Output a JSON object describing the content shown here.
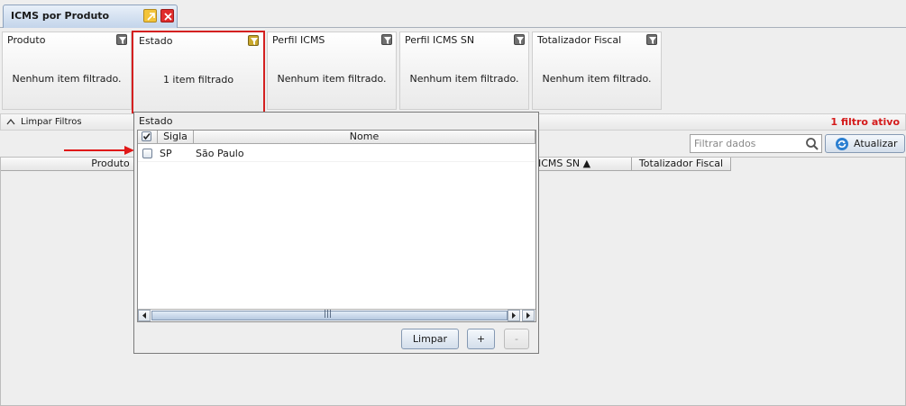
{
  "tab": {
    "title": "ICMS por Produto"
  },
  "cards": [
    {
      "title": "Produto",
      "message": "Nenhum item filtrado."
    },
    {
      "title": "Estado",
      "message": "1 item filtrado"
    },
    {
      "title": "Perfil ICMS",
      "message": "Nenhum item filtrado."
    },
    {
      "title": "Perfil ICMS SN",
      "message": "Nenhum item filtrado."
    },
    {
      "title": "Totalizador Fiscal",
      "message": "Nenhum item filtrado."
    }
  ],
  "clear_filters": {
    "label": "Limpar Filtros",
    "active_count": "1 filtro ativo"
  },
  "search": {
    "placeholder": "Filtrar dados"
  },
  "refresh": {
    "label": "Atualizar"
  },
  "main_table": {
    "columns": [
      "Produto",
      "ICMS SN ▲",
      "Totalizador Fiscal"
    ]
  },
  "popup": {
    "title": "Estado",
    "columns": {
      "sigla": "Sigla",
      "nome": "Nome"
    },
    "rows": [
      {
        "sigla": "SP",
        "nome": "São Paulo",
        "checked": false
      }
    ],
    "scroll_grip": "|||",
    "buttons": {
      "clear": "Limpar",
      "add": "+",
      "remove": "-"
    }
  },
  "colors": {
    "accent_red": "#d42020",
    "selection_blue": "#c3d4ea"
  },
  "icons": [
    "navigate-icon",
    "close-icon",
    "funnel-icon",
    "collapse-arrow-icon",
    "search-icon",
    "refresh-icon",
    "checkbox-icon",
    "red-arrow-icon"
  ]
}
